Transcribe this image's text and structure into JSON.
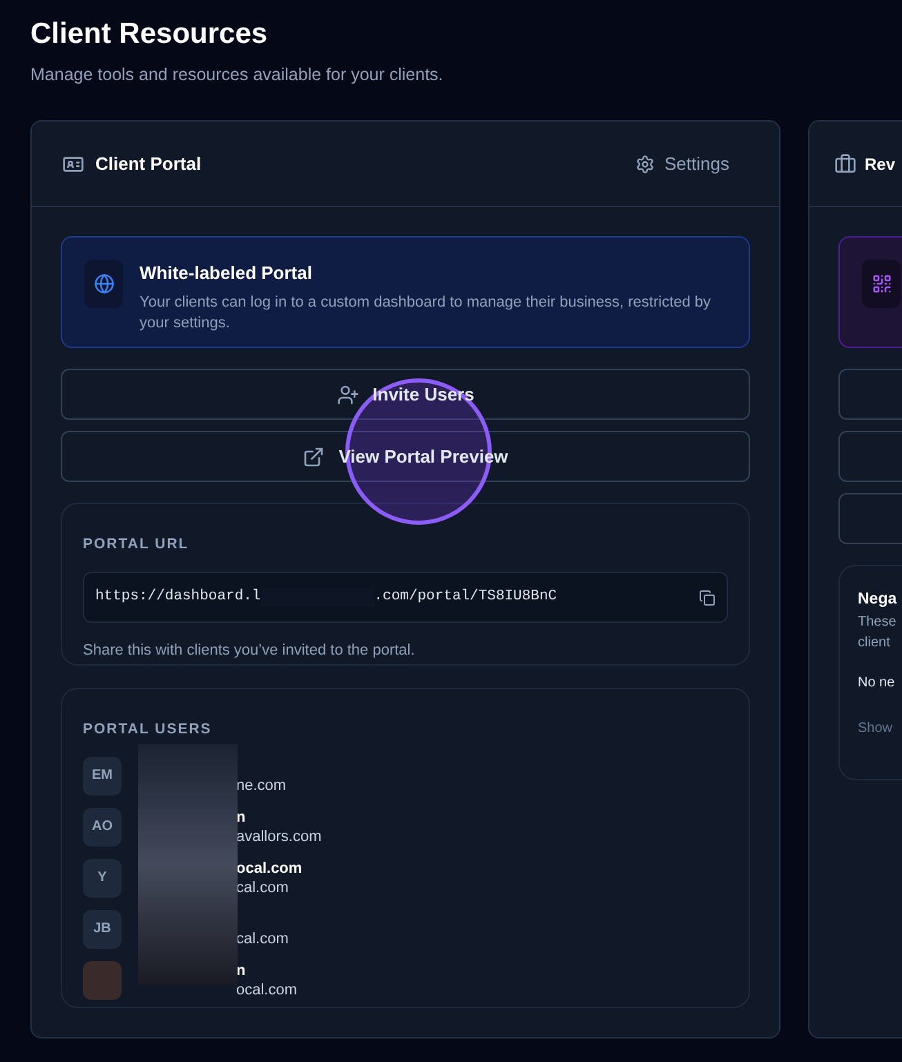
{
  "page": {
    "title": "Client Resources",
    "subtitle": "Manage tools and resources available for your clients."
  },
  "portal_card": {
    "title": "Client Portal",
    "settings_label": "Settings",
    "info": {
      "title": "White-labeled Portal",
      "description": "Your clients can log in to a custom dashboard to manage their business, restricted by your settings."
    },
    "buttons": [
      {
        "kind": "invite",
        "label": "Invite Users"
      },
      {
        "kind": "external",
        "label": "View Portal Preview"
      }
    ],
    "url_section": {
      "heading": "PORTAL URL",
      "url_start": "https://dashboard.l",
      "url_end": ".com/portal/TS8IU8BnC",
      "hint": "Share this with clients you’ve invited to the portal."
    },
    "users_section": {
      "heading": "PORTAL USERS",
      "users": [
        {
          "kind": "initials",
          "initials": "EM",
          "email": "ne.com"
        },
        {
          "kind": "initials",
          "initials": "AO",
          "name": "n",
          "email": "avallors.com"
        },
        {
          "kind": "initials",
          "initials": "Y",
          "name": "ocal.com",
          "email": "cal.com"
        },
        {
          "kind": "initials",
          "initials": "JB",
          "email": "cal.com"
        },
        {
          "kind": "photo",
          "name": "n",
          "email": "ocal.com"
        }
      ]
    }
  },
  "review_card": {
    "title": "Rev",
    "negative": {
      "title": "Nega",
      "description_lines": [
        "These",
        "client"
      ],
      "empty": "No ne",
      "footer": "Show"
    }
  }
}
